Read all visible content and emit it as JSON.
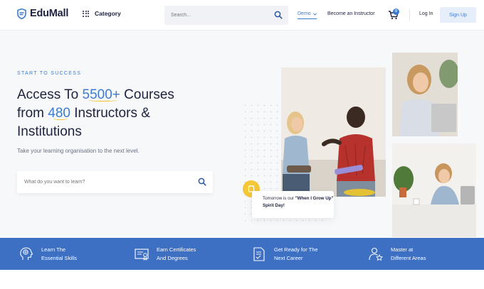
{
  "header": {
    "logo": "EduMall",
    "category_label": "Category",
    "search_placeholder": "Search...",
    "nav_demo": "Demo",
    "nav_instructor": "Become an Instructor",
    "cart_count": "0",
    "login": "Log In",
    "signup": "Sign Up"
  },
  "hero": {
    "eyebrow": "START TO SUCCESS",
    "line1_a": "Access To ",
    "line1_hl": "5500+",
    "line1_b": " Courses",
    "line2_a": "from ",
    "line2_hl": "480",
    "line2_b": " Instructors &",
    "line3": "Institutions",
    "tagline": "Take your learning organisation to the next level.",
    "search_placeholder": "What do you want to learn?",
    "toast_prefix": "Tomorrow is our ",
    "toast_bold": "\"When I Grow Up\" Spirit Day!"
  },
  "features": [
    {
      "line1": "Learn The",
      "line2": "Essential Skills",
      "icon": "brain-head-icon"
    },
    {
      "line1": "Earn Certificates",
      "line2": "And Degrees",
      "icon": "certificate-icon"
    },
    {
      "line1": "Get Ready for The",
      "line2": "Next Career",
      "icon": "career-checklist-icon"
    },
    {
      "line1": "Master at",
      "line2": "Different Areas",
      "icon": "star-user-icon"
    }
  ],
  "colors": {
    "accent": "#3d7bd1",
    "feature_bar": "#3d6fc2",
    "highlight_underline": "#f4c12a",
    "toast_icon": "#f3c736"
  }
}
